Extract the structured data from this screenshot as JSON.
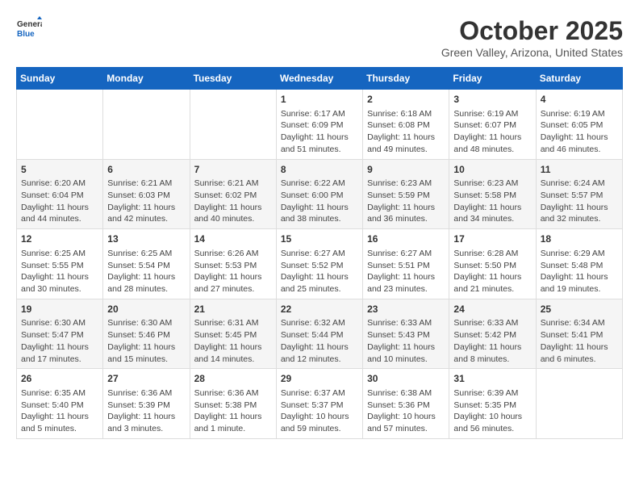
{
  "header": {
    "logo_line1": "General",
    "logo_line2": "Blue",
    "month": "October 2025",
    "location": "Green Valley, Arizona, United States"
  },
  "weekdays": [
    "Sunday",
    "Monday",
    "Tuesday",
    "Wednesday",
    "Thursday",
    "Friday",
    "Saturday"
  ],
  "weeks": [
    [
      {
        "day": "",
        "info": ""
      },
      {
        "day": "",
        "info": ""
      },
      {
        "day": "",
        "info": ""
      },
      {
        "day": "1",
        "info": "Sunrise: 6:17 AM\nSunset: 6:09 PM\nDaylight: 11 hours\nand 51 minutes."
      },
      {
        "day": "2",
        "info": "Sunrise: 6:18 AM\nSunset: 6:08 PM\nDaylight: 11 hours\nand 49 minutes."
      },
      {
        "day": "3",
        "info": "Sunrise: 6:19 AM\nSunset: 6:07 PM\nDaylight: 11 hours\nand 48 minutes."
      },
      {
        "day": "4",
        "info": "Sunrise: 6:19 AM\nSunset: 6:05 PM\nDaylight: 11 hours\nand 46 minutes."
      }
    ],
    [
      {
        "day": "5",
        "info": "Sunrise: 6:20 AM\nSunset: 6:04 PM\nDaylight: 11 hours\nand 44 minutes."
      },
      {
        "day": "6",
        "info": "Sunrise: 6:21 AM\nSunset: 6:03 PM\nDaylight: 11 hours\nand 42 minutes."
      },
      {
        "day": "7",
        "info": "Sunrise: 6:21 AM\nSunset: 6:02 PM\nDaylight: 11 hours\nand 40 minutes."
      },
      {
        "day": "8",
        "info": "Sunrise: 6:22 AM\nSunset: 6:00 PM\nDaylight: 11 hours\nand 38 minutes."
      },
      {
        "day": "9",
        "info": "Sunrise: 6:23 AM\nSunset: 5:59 PM\nDaylight: 11 hours\nand 36 minutes."
      },
      {
        "day": "10",
        "info": "Sunrise: 6:23 AM\nSunset: 5:58 PM\nDaylight: 11 hours\nand 34 minutes."
      },
      {
        "day": "11",
        "info": "Sunrise: 6:24 AM\nSunset: 5:57 PM\nDaylight: 11 hours\nand 32 minutes."
      }
    ],
    [
      {
        "day": "12",
        "info": "Sunrise: 6:25 AM\nSunset: 5:55 PM\nDaylight: 11 hours\nand 30 minutes."
      },
      {
        "day": "13",
        "info": "Sunrise: 6:25 AM\nSunset: 5:54 PM\nDaylight: 11 hours\nand 28 minutes."
      },
      {
        "day": "14",
        "info": "Sunrise: 6:26 AM\nSunset: 5:53 PM\nDaylight: 11 hours\nand 27 minutes."
      },
      {
        "day": "15",
        "info": "Sunrise: 6:27 AM\nSunset: 5:52 PM\nDaylight: 11 hours\nand 25 minutes."
      },
      {
        "day": "16",
        "info": "Sunrise: 6:27 AM\nSunset: 5:51 PM\nDaylight: 11 hours\nand 23 minutes."
      },
      {
        "day": "17",
        "info": "Sunrise: 6:28 AM\nSunset: 5:50 PM\nDaylight: 11 hours\nand 21 minutes."
      },
      {
        "day": "18",
        "info": "Sunrise: 6:29 AM\nSunset: 5:48 PM\nDaylight: 11 hours\nand 19 minutes."
      }
    ],
    [
      {
        "day": "19",
        "info": "Sunrise: 6:30 AM\nSunset: 5:47 PM\nDaylight: 11 hours\nand 17 minutes."
      },
      {
        "day": "20",
        "info": "Sunrise: 6:30 AM\nSunset: 5:46 PM\nDaylight: 11 hours\nand 15 minutes."
      },
      {
        "day": "21",
        "info": "Sunrise: 6:31 AM\nSunset: 5:45 PM\nDaylight: 11 hours\nand 14 minutes."
      },
      {
        "day": "22",
        "info": "Sunrise: 6:32 AM\nSunset: 5:44 PM\nDaylight: 11 hours\nand 12 minutes."
      },
      {
        "day": "23",
        "info": "Sunrise: 6:33 AM\nSunset: 5:43 PM\nDaylight: 11 hours\nand 10 minutes."
      },
      {
        "day": "24",
        "info": "Sunrise: 6:33 AM\nSunset: 5:42 PM\nDaylight: 11 hours\nand 8 minutes."
      },
      {
        "day": "25",
        "info": "Sunrise: 6:34 AM\nSunset: 5:41 PM\nDaylight: 11 hours\nand 6 minutes."
      }
    ],
    [
      {
        "day": "26",
        "info": "Sunrise: 6:35 AM\nSunset: 5:40 PM\nDaylight: 11 hours\nand 5 minutes."
      },
      {
        "day": "27",
        "info": "Sunrise: 6:36 AM\nSunset: 5:39 PM\nDaylight: 11 hours\nand 3 minutes."
      },
      {
        "day": "28",
        "info": "Sunrise: 6:36 AM\nSunset: 5:38 PM\nDaylight: 11 hours\nand 1 minute."
      },
      {
        "day": "29",
        "info": "Sunrise: 6:37 AM\nSunset: 5:37 PM\nDaylight: 10 hours\nand 59 minutes."
      },
      {
        "day": "30",
        "info": "Sunrise: 6:38 AM\nSunset: 5:36 PM\nDaylight: 10 hours\nand 57 minutes."
      },
      {
        "day": "31",
        "info": "Sunrise: 6:39 AM\nSunset: 5:35 PM\nDaylight: 10 hours\nand 56 minutes."
      },
      {
        "day": "",
        "info": ""
      }
    ]
  ]
}
